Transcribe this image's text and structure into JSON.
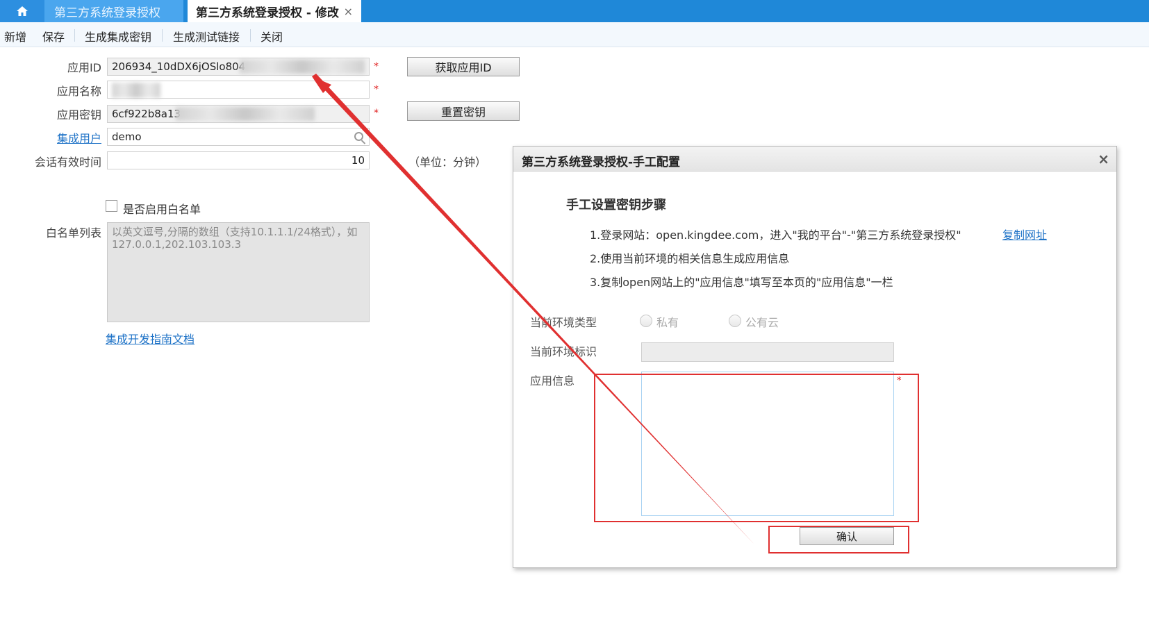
{
  "tabs": {
    "inactive_label": "第三方系统登录授权",
    "active_label": "第三方系统登录授权 - 修改",
    "close_glyph": "×"
  },
  "toolbar": {
    "new_label": "新增",
    "save_label": "保存",
    "gen_key_label": "生成集成密钥",
    "gen_test_link_label": "生成测试链接",
    "close_label": "关闭"
  },
  "form": {
    "app_id_label": "应用ID",
    "app_id_value": "206934_10dDX6jOSlo804",
    "app_name_label": "应用名称",
    "app_key_label": "应用密钥",
    "app_key_value": "6cf922b8a13",
    "integration_user_label": "集成用户",
    "integration_user_value": "demo",
    "session_timeout_label": "会话有效时间",
    "session_timeout_value": "10",
    "unit_text": "（单位：分钟）",
    "required_mark": "*",
    "whitelist_enable_label": "是否启用白名单",
    "whitelist_label": "白名单列表",
    "whitelist_placeholder": "以英文逗号,分隔的数组（支持10.1.1.1/24格式），如127.0.0.1,202.103.103.3",
    "guide_link": "集成开发指南文档",
    "get_app_id_button": "获取应用ID",
    "reset_key_button": "重置密钥"
  },
  "dialog": {
    "title": "第三方系统登录授权-手工配置",
    "close_glyph": "×",
    "subtitle": "手工设置密钥步骤",
    "steps": [
      "1.登录网站：open.kingdee.com，进入\"我的平台\"-\"第三方系统登录授权\"",
      "2.使用当前环境的相关信息生成应用信息",
      "3.复制open网站上的\"应用信息\"填写至本页的\"应用信息\"一栏"
    ],
    "copy_url_link": "复制网址",
    "env_type_label": "当前环境类型",
    "env_private_label": "私有",
    "env_public_label": "公有云",
    "env_id_label": "当前环境标识",
    "app_info_label": "应用信息",
    "required_mark": "*",
    "confirm_button": "确认"
  },
  "colors": {
    "tabbar": "#1f88d8",
    "link": "#1f73c7",
    "annotation": "#e03030",
    "required": "#e02020"
  }
}
